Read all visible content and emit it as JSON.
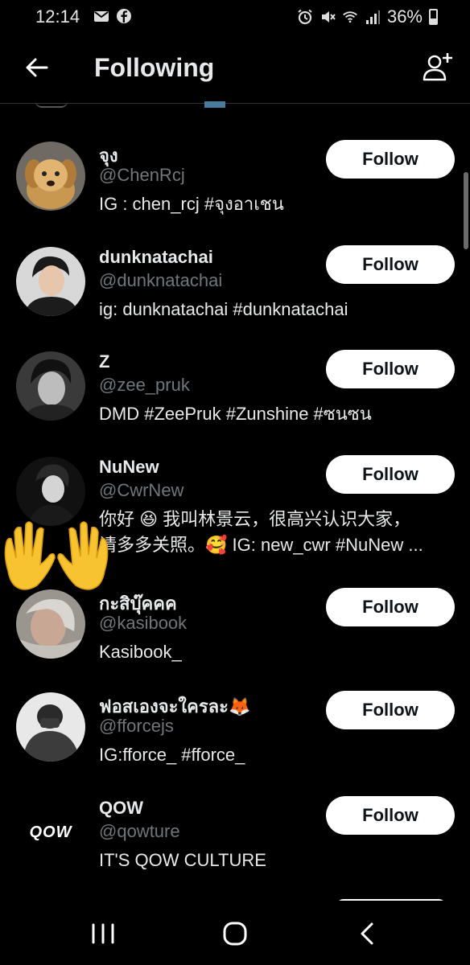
{
  "status_bar": {
    "time": "12:14",
    "battery": "36%",
    "battery_level": 0.36
  },
  "header": {
    "title": "Following"
  },
  "users": [
    {
      "name": "จุง",
      "handle": "@ChenRcj",
      "bio": "IG : chen_rcj #จุงอาเชน",
      "button": "Follow"
    },
    {
      "name": "dunknatachai",
      "handle": "@dunknatachai",
      "bio": "ig: dunknatachai #dunknatachai",
      "button": "Follow"
    },
    {
      "name": "Z",
      "handle": "@zee_pruk",
      "bio": "DMD #ZeePruk #Zunshine #ซนซน",
      "button": "Follow"
    },
    {
      "name": "NuNew",
      "handle": "@CwrNew",
      "bio_line1": "你好 😆 我叫林景云，很高兴认识大家，",
      "bio_line2": "请多多关照。🥰 IG: new_cwr #NuNew ...",
      "button": "Follow"
    },
    {
      "name": "กะสิบุ๊คคค",
      "handle": "@kasibook",
      "bio": "Kasibook_",
      "button": "Follow"
    },
    {
      "name": "ฟอสเองจะใครละ🦊",
      "handle": "@fforcejs",
      "bio": "IG:fforce_ #fforce_",
      "button": "Follow"
    },
    {
      "name": "QOW",
      "handle": "@qowture",
      "bio": "IT'S QOW CULTURE",
      "button": "Follow",
      "avatar_text": "QOW"
    }
  ],
  "colors": {
    "background": "#000000",
    "handle": "#71767b",
    "button_bg": "#ffffff",
    "button_text": "#0f1419"
  },
  "icons": [
    "back-arrow-icon",
    "add-user-icon",
    "mail-icon",
    "facebook-icon",
    "alarm-icon",
    "mute-icon",
    "wifi-icon",
    "signal-icon",
    "battery-icon",
    "clapping-hands-emoji",
    "recent-apps-icon",
    "home-icon",
    "back-nav-icon"
  ]
}
